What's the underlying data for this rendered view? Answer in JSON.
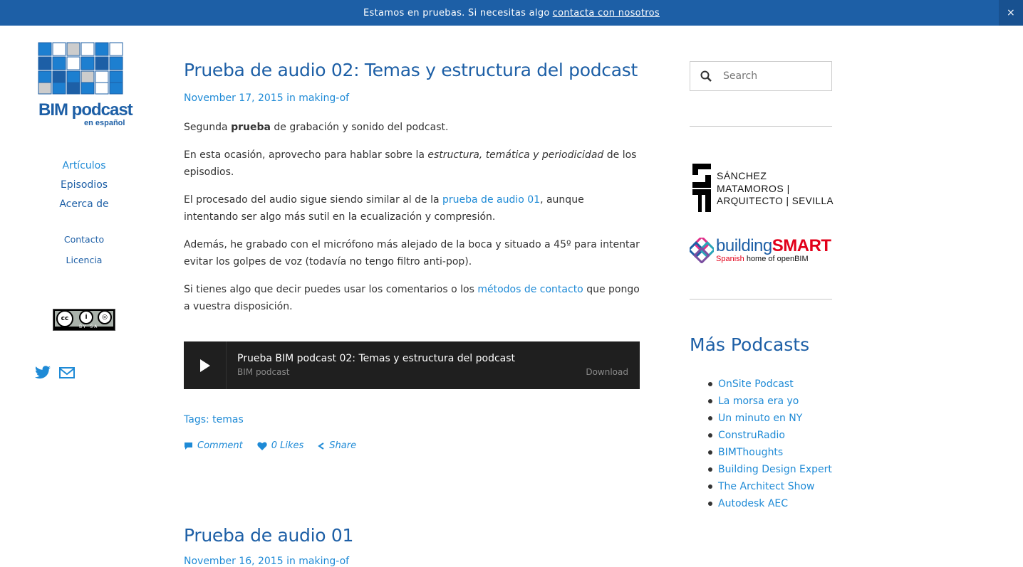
{
  "notice": {
    "text": "Estamos en pruebas. Si necesitas algo",
    "link": "contacta con nosotros",
    "close": "×"
  },
  "logo": {
    "title": "BIM podcast",
    "subtitle": "en español"
  },
  "nav": {
    "items": [
      "Artículos",
      "Episodios",
      "Acerca de"
    ],
    "secondary": [
      "Contacto",
      "Licencia"
    ]
  },
  "license": {
    "badge_text": "BY   SA"
  },
  "post1": {
    "title": "Prueba de audio 02: Temas y estructura del podcast",
    "date": "November 17, 2015",
    "in": "in",
    "category": "making-of",
    "p1_a": "Segunda ",
    "p1_b": "prueba",
    "p1_c": " de grabación y sonido del podcast.",
    "p2_a": "En esta ocasión, aprovecho para hablar sobre la ",
    "p2_b": "estructura, temática y periodicidad",
    "p2_c": " de los episodios.",
    "p3_a": "El procesado del audio sigue siendo similar al de la ",
    "p3_link": "prueba de audio 01",
    "p3_c": ", aunque intentando ser algo más sutil en la ecualización y compresión.",
    "p4": "Además, he grabado con el micrófono más alejado de la boca y situado a 45º para intentar evitar los golpes de voz (todavía no tengo filtro anti-pop).",
    "p5_a": "Si tienes algo que decir puedes usar los comentarios o los ",
    "p5_link": "métodos de contacto",
    "p5_c": " que pongo a vuestra disposición.",
    "player": {
      "title": "Prueba BIM podcast 02: Temas y estructura del podcast",
      "author": "BIM podcast",
      "download": "Download"
    },
    "tags_label": "Tags:",
    "tag": "temas",
    "actions": {
      "comment": "Comment",
      "likes": "0 Likes",
      "share": "Share"
    }
  },
  "post2": {
    "title": "Prueba de audio 01",
    "date": "November 16, 2015",
    "in": "in",
    "category": "making-of"
  },
  "search": {
    "placeholder": "Search"
  },
  "sponsor1": {
    "line1": "SÁNCHEZ",
    "line2": "MATAMOROS |",
    "line3": "ARQUITECTO | SEVILLA"
  },
  "sponsor2": {
    "name_a": "building",
    "name_b": "SMART",
    "sub_a": "Spanish",
    "sub_b": " home of openBIM"
  },
  "more_podcasts": {
    "title": "Más Podcasts",
    "items": [
      "OnSite Podcast",
      "La morsa era yo",
      "Un minuto en NY",
      "ConstruRadio",
      "BIMThoughts",
      "Building Design Expert",
      "The Architect Show",
      "Autodesk AEC"
    ]
  }
}
